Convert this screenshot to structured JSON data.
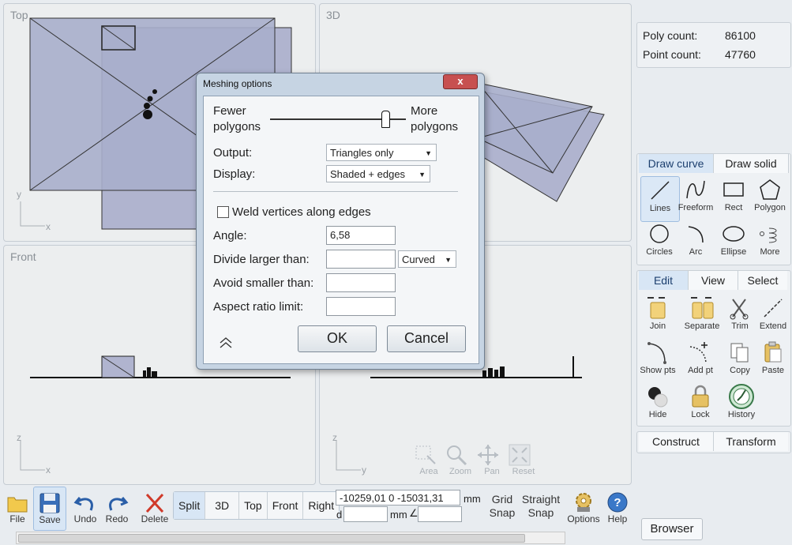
{
  "viewports": {
    "top": {
      "label": "Top",
      "axis_v": "y",
      "axis_h": "x"
    },
    "three_d": {
      "label": "3D"
    },
    "front": {
      "label": "Front",
      "axis_v": "z",
      "axis_h": "x"
    },
    "right": {
      "axis_v": "z",
      "axis_h": "y"
    }
  },
  "counts": {
    "poly_label": "Poly count:",
    "poly_value": "86100",
    "point_label": "Point count:",
    "point_value": "47760"
  },
  "draw_tabs": {
    "curve": "Draw curve",
    "solid": "Draw solid"
  },
  "draw_tools": [
    "Lines",
    "Freeform",
    "Rect",
    "Polygon",
    "Circles",
    "Arc",
    "Ellipse",
    "More"
  ],
  "edit_tabs": {
    "edit": "Edit",
    "view": "View",
    "select": "Select"
  },
  "edit_tools": [
    "Join",
    "Separate",
    "Trim",
    "Extend",
    "Show pts",
    "Add pt",
    "Copy",
    "Paste",
    "Hide",
    "Lock",
    "History"
  ],
  "bottom_tabs": {
    "construct": "Construct",
    "transform": "Transform"
  },
  "nav_tools": [
    "Area",
    "Zoom",
    "Pan",
    "Reset"
  ],
  "toolbar": {
    "file": "File",
    "save": "Save",
    "undo": "Undo",
    "redo": "Redo",
    "delete": "Delete",
    "views": [
      "Split",
      "3D",
      "Top",
      "Front",
      "Right"
    ],
    "coords": "-10259,01  0  -15031,31",
    "unit": "mm",
    "d_label": "d",
    "d_unit": "mm",
    "angle_symbol": "∠",
    "grid_snap_1": "Grid",
    "grid_snap_2": "Snap",
    "straight_snap_1": "Straight",
    "straight_snap_2": "Snap",
    "options": "Options",
    "help": "Help",
    "browser": "Browser"
  },
  "dialog": {
    "title": "Meshing options",
    "close": "x",
    "fewer_1": "Fewer",
    "fewer_2": "polygons",
    "more_1": "More",
    "more_2": "polygons",
    "slider_level": 0.85,
    "output_label": "Output:",
    "output_value": "Triangles only",
    "display_label": "Display:",
    "display_value": "Shaded + edges",
    "weld_label": "Weld vertices along edges",
    "angle_label": "Angle:",
    "angle_value": "6,58",
    "divide_label": "Divide larger than:",
    "divide_value": "",
    "divide_mode": "Curved",
    "avoid_label": "Avoid smaller than:",
    "avoid_value": "",
    "aspect_label": "Aspect ratio limit:",
    "aspect_value": "",
    "ok": "OK",
    "cancel": "Cancel"
  },
  "colors": {
    "plane_fill": "#b0b4cf",
    "accent": "#d8e6f5",
    "close": "#c75050"
  }
}
